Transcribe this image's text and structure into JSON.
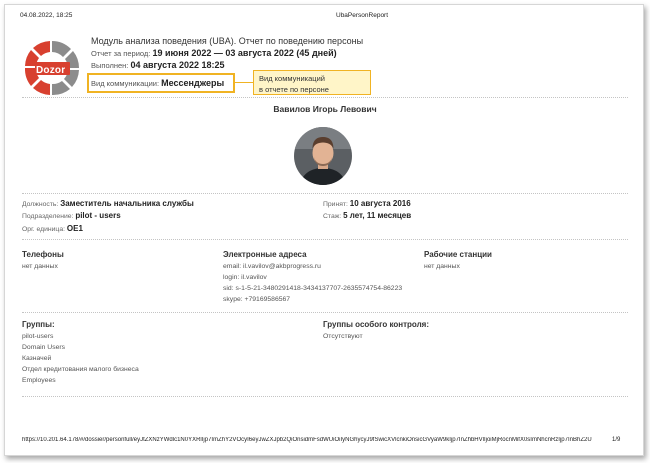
{
  "print_header": {
    "datetime": "04.08.2022, 18:25",
    "doc_title": "UbaPersonReport"
  },
  "logo": {
    "text": "Dozor"
  },
  "report": {
    "title": "Модуль анализа поведения (UBA). Отчет по поведению персоны",
    "period_label": "Отчет за период:",
    "period_value": "19 июня 2022 — 03 августа 2022 (45 дней)",
    "done_label": "Выполнен:",
    "done_value": "04 августа 2022 18:25",
    "comm_label": "Вид коммуникации:",
    "comm_value": "Мессенджеры"
  },
  "tooltip": {
    "line1": "Вид коммуникаций",
    "line2": "в отчете по персоне"
  },
  "person": {
    "name": "Вавилов Игорь Левович",
    "position_label": "Должность:",
    "position_value": "Заместитель начальника службы",
    "department_label": "Подразделение:",
    "department_value": "pilot - users",
    "org_unit_label": "Орг. единица:",
    "org_unit_value": "OE1",
    "hired_label": "Принят:",
    "hired_value": "10 августа 2016",
    "tenure_label": "Стаж:",
    "tenure_value": "5 лет, 11 месяцев"
  },
  "phones": {
    "title": "Телефоны",
    "value": "нет данных"
  },
  "addresses": {
    "title": "Электронные адреса",
    "lines": [
      "email: il.vavilov@akbprogress.ru",
      "login: il.vavilov",
      "sid: s-1-5-21-3480291418-3434137707-2635574754-86223",
      "skype: +79169586567"
    ]
  },
  "workstations": {
    "title": "Рабочие станции",
    "value": "нет данных"
  },
  "groups": {
    "title": "Группы:",
    "items": [
      "pilot-users",
      "Domain Users",
      "Казначей",
      "Отдел кредитования малого бизнеса",
      "Employees"
    ]
  },
  "special_groups": {
    "title": "Группы особого контроля:",
    "value": "Отсутствуют"
  },
  "footer": {
    "url": "https://10.201.64.178/#/dossier/personfull/eyJtZXNzYWdlc1N0YXRlIjp7ImZhY2VOcyI6eyJwZXJpb2QiOnsidmFsdWUiOiIyNGhycyJ9fSwicXVlcnkiOnsicGVyaW9kIjp7InZhbHVlIjoiMjRocnMifX0sImNhcnRzIjp7InBhZ2UiOjF9fX0=",
    "page": "1/9"
  },
  "colors": {
    "accent": "#f0b323",
    "tooltip_bg": "#fff5c8",
    "logo_red": "#d8402f",
    "logo_grey": "#8c8c8c"
  }
}
